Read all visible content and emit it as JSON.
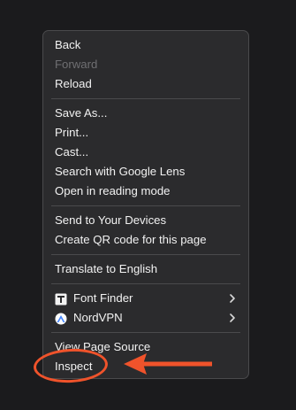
{
  "context_menu": {
    "groups": [
      [
        {
          "label": "Back",
          "disabled": false
        },
        {
          "label": "Forward",
          "disabled": true
        },
        {
          "label": "Reload",
          "disabled": false
        }
      ],
      [
        {
          "label": "Save As..."
        },
        {
          "label": "Print..."
        },
        {
          "label": "Cast..."
        },
        {
          "label": "Search with Google Lens"
        },
        {
          "label": "Open in reading mode"
        }
      ],
      [
        {
          "label": "Send to Your Devices"
        },
        {
          "label": "Create QR code for this page"
        }
      ],
      [
        {
          "label": "Translate to English"
        }
      ],
      [
        {
          "label": "Font Finder",
          "icon": "font-finder-icon",
          "submenu": true
        },
        {
          "label": "NordVPN",
          "icon": "nordvpn-icon",
          "submenu": true
        }
      ],
      [
        {
          "label": "View Page Source"
        },
        {
          "label": "Inspect",
          "highlighted": true
        }
      ]
    ]
  },
  "annotation": {
    "color": "#f0532b",
    "target": "Inspect"
  },
  "colors": {
    "background": "#1b1b1d",
    "menu_background": "#2b2b2d",
    "menu_border": "#4a4a4c",
    "text": "#f2f2f2",
    "text_disabled": "#6f6f72"
  }
}
